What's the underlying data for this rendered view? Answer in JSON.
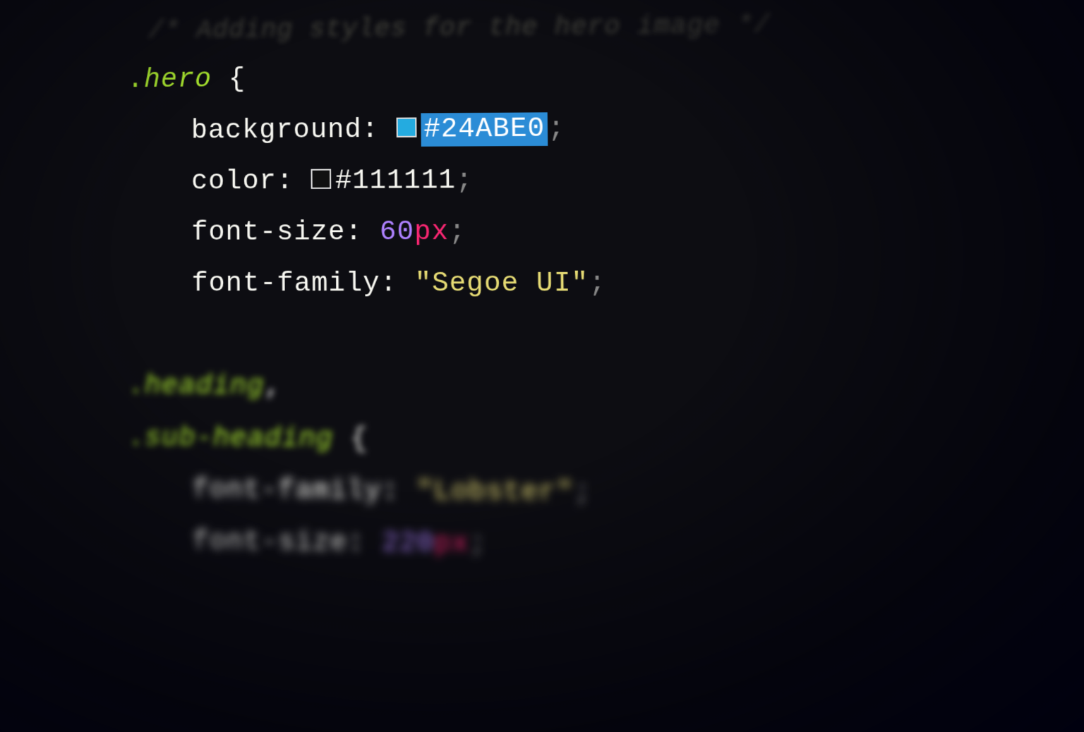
{
  "code": {
    "comment": "/* Adding styles for the hero image */",
    "rule1": {
      "selector_dot": ".",
      "selector": "hero",
      "open_brace": " {",
      "declarations": {
        "background": {
          "property": "background",
          "colon": ": ",
          "value_hex": "#24ABE0",
          "semicolon": ";"
        },
        "color": {
          "property": "color",
          "colon": ": ",
          "value_hex": "#111111",
          "semicolon": ";"
        },
        "font_size": {
          "property": "font-size",
          "colon": ": ",
          "number": "60",
          "unit": "px",
          "semicolon": ";"
        },
        "font_family": {
          "property": "font-family",
          "colon": ": ",
          "quote_open": "\"",
          "value": "Segoe UI",
          "quote_close": "\"",
          "semicolon": ";"
        }
      }
    },
    "rule2": {
      "selector1_dot": ".",
      "selector1": "heading",
      "comma": ",",
      "selector2_dot": ".",
      "selector2": "sub-heading",
      "open_brace": " {",
      "declarations": {
        "font_family": {
          "property": "font-family",
          "colon": ": ",
          "quote_open": "\"",
          "value": "Lobster",
          "quote_close": "\"",
          "semicolon": ";"
        },
        "font_size": {
          "property": "font-size",
          "colon": ": ",
          "number": "220",
          "unit": "px",
          "semicolon": ";"
        }
      }
    }
  },
  "colors": {
    "swatch_blue": "#24ABE0",
    "swatch_dark": "#111111"
  }
}
